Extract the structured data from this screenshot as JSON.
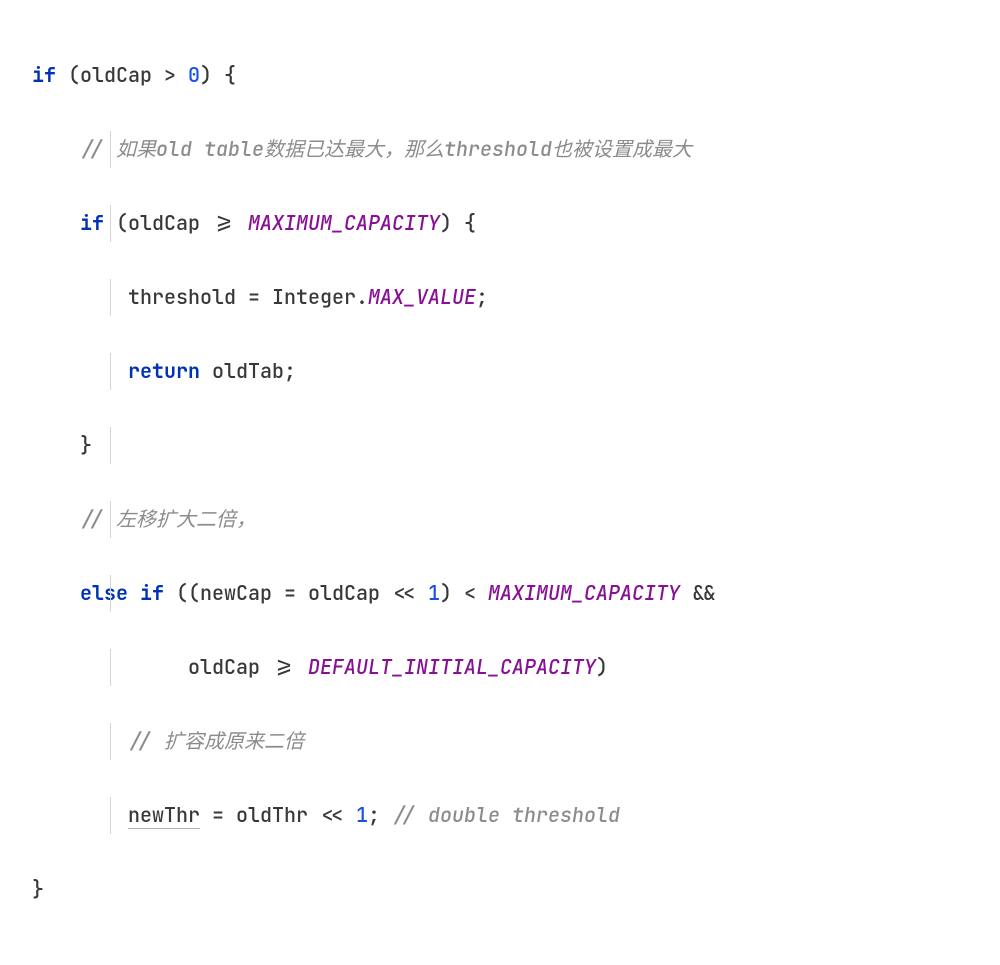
{
  "code": {
    "l1": {
      "kw_if": "if",
      "open": " (oldCap > ",
      "num": "0",
      "close": ") {"
    },
    "l2": {
      "comment": "// 如果old table数据已达最大，那么threshold也被设置成最大"
    },
    "l3": {
      "kw_if": "if",
      "open": " (oldCap >= ",
      "const": "MAXIMUM_CAPACITY",
      "close": ") {"
    },
    "l4": {
      "lhs": "threshold = Integer.",
      "const": "MAX_VALUE",
      "semi": ";"
    },
    "l5": {
      "kw_return": "return",
      "rest": " oldTab;"
    },
    "l6": {
      "brace": "}"
    },
    "l7": {
      "comment": "// 左移扩大二倍，"
    },
    "l8": {
      "kw_else": "else",
      "sp1": " ",
      "kw_if": "if",
      "open": " ((newCap = oldCap << ",
      "num": "1",
      "mid": ") < ",
      "const": "MAXIMUM_CAPACITY",
      "andand": " &&"
    },
    "l9": {
      "text": "oldCap >= ",
      "const": "DEFAULT_INITIAL_CAPACITY",
      "close": ")"
    },
    "l10": {
      "comment": "// 扩容成原来二倍"
    },
    "l11": {
      "newThr": "newThr",
      "rest": " = oldThr << ",
      "num": "1",
      "semi": "; ",
      "comment": "// double threshold"
    },
    "l12": {
      "brace": "}"
    }
  }
}
